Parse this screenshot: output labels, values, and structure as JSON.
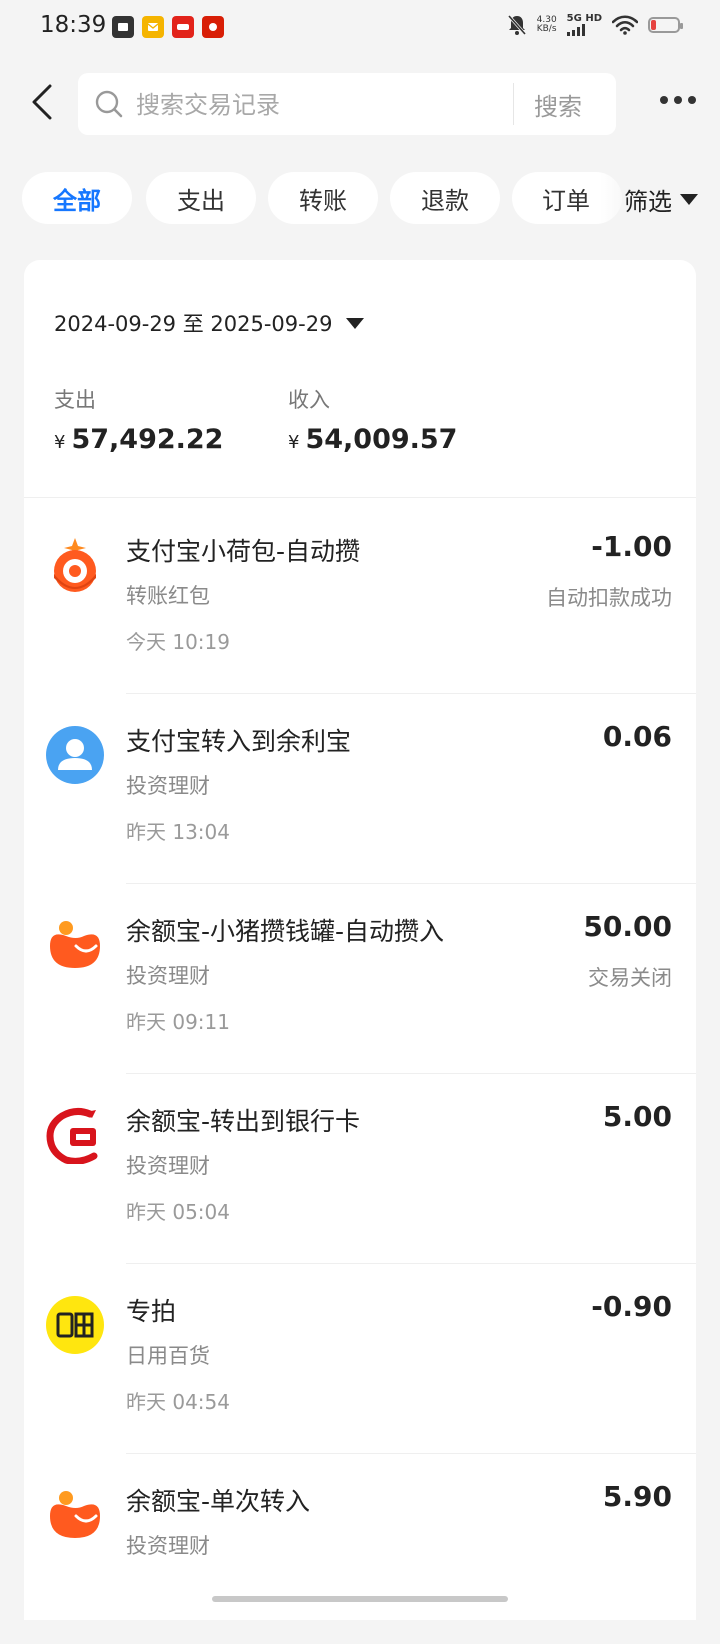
{
  "status_bar": {
    "time": "18:39",
    "network_speed": "4.30",
    "network_speed_unit": "KB/s",
    "network_type": "5G HD",
    "battery_color": "#e64340"
  },
  "header": {
    "search_placeholder": "搜索交易记录",
    "search_button": "搜索"
  },
  "filters": {
    "tabs": [
      {
        "label": "全部",
        "active": true
      },
      {
        "label": "支出",
        "active": false
      },
      {
        "label": "转账",
        "active": false
      },
      {
        "label": "退款",
        "active": false
      },
      {
        "label": "订单",
        "active": false
      }
    ],
    "filter_label": "筛选"
  },
  "summary": {
    "date_range": "2024-09-29 至 2025-09-29",
    "currency": "¥",
    "expense_label": "支出",
    "expense_value": "57,492.22",
    "income_label": "收入",
    "income_value": "54,009.57"
  },
  "transactions": [
    {
      "title": "支付宝小荷包-自动攒",
      "category": "转账红包",
      "time": "今天 10:19",
      "amount": "-1.00",
      "status": "自动扣款成功",
      "icon": "alipay-pocket-icon"
    },
    {
      "title": "支付宝转入到余利宝",
      "category": "投资理财",
      "time": "昨天 13:04",
      "amount": "0.06",
      "status": "",
      "icon": "user-avatar-icon"
    },
    {
      "title": "余额宝-小猪攒钱罐-自动攒入",
      "category": "投资理财",
      "time": "昨天 09:11",
      "amount": "50.00",
      "status": "交易关闭",
      "icon": "yuebao-icon"
    },
    {
      "title": "余额宝-转出到银行卡",
      "category": "投资理财",
      "time": "昨天 05:04",
      "amount": "5.00",
      "status": "",
      "icon": "bank-card-icon"
    },
    {
      "title": "专拍",
      "category": "日用百货",
      "time": "昨天 04:54",
      "amount": "-0.90",
      "status": "",
      "icon": "xianyu-icon"
    },
    {
      "title": "余额宝-单次转入",
      "category": "投资理财",
      "time": "",
      "amount": "5.90",
      "status": "",
      "icon": "yuebao-icon"
    }
  ],
  "colors": {
    "accent": "#1677ff",
    "background": "#f4f4f4",
    "alipay_orange": "#ff5a1f",
    "avatar_blue": "#4aa3f2",
    "xianyu_yellow": "#ffe60f"
  }
}
